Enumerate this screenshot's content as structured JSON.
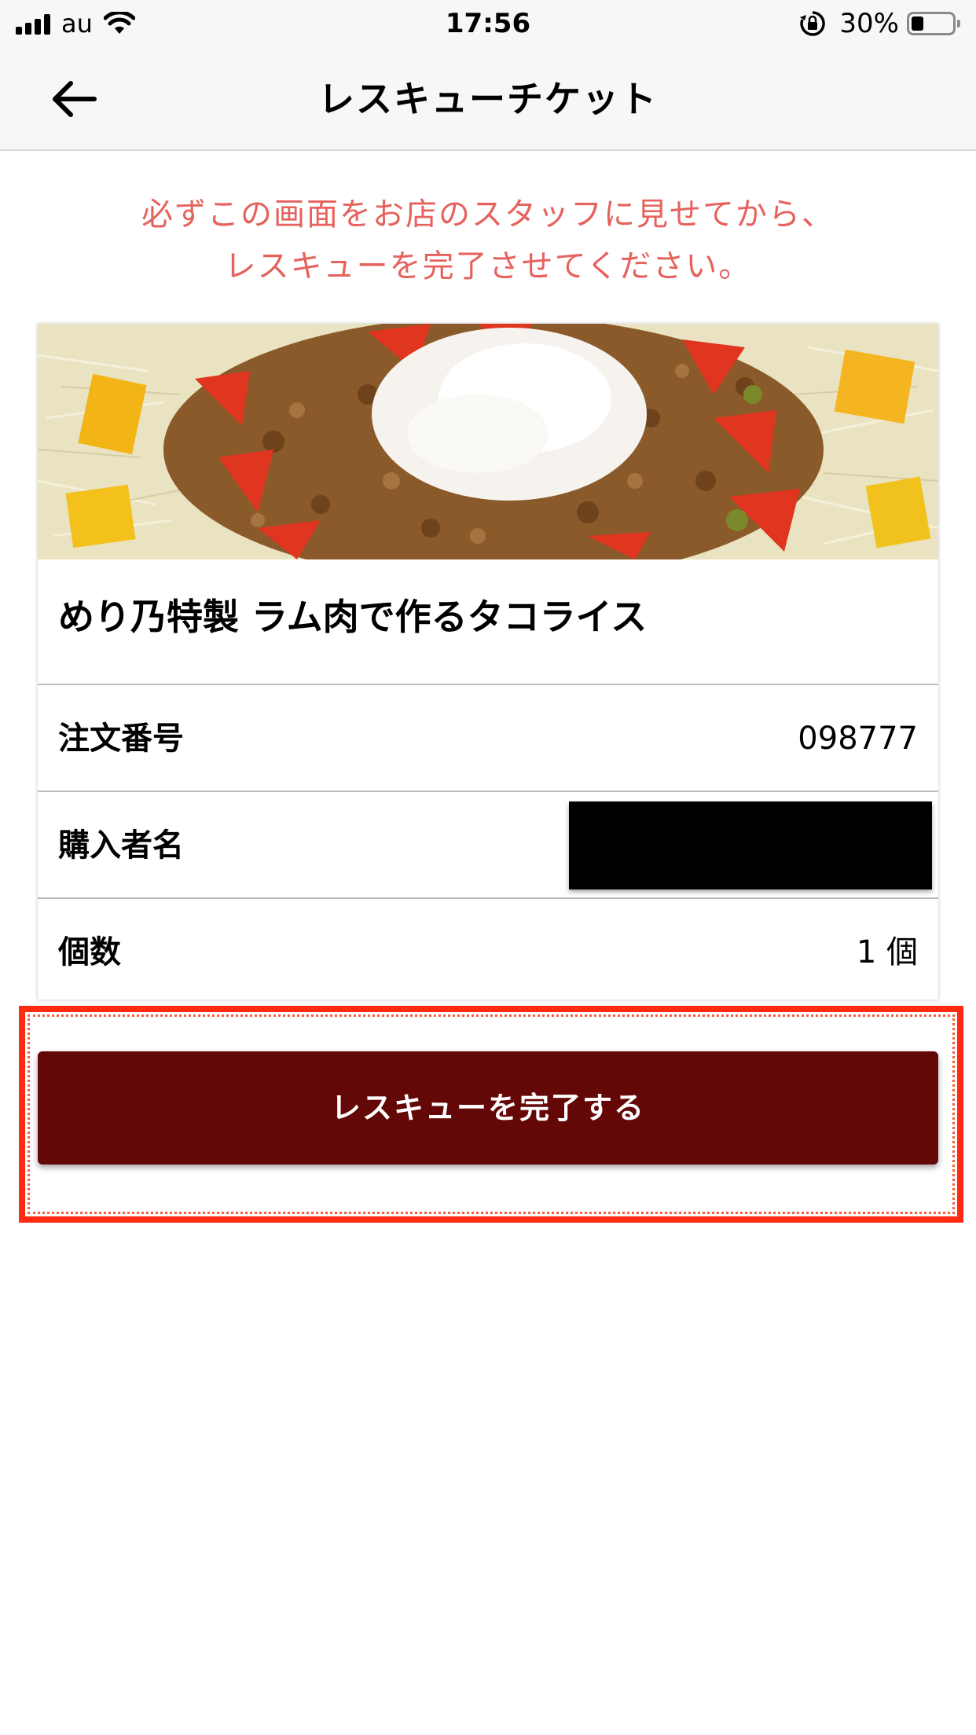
{
  "status_bar": {
    "carrier": "au",
    "time": "17:56",
    "battery_percent": "30%",
    "battery_level": 0.3,
    "icons": [
      "signal-icon",
      "wifi-icon",
      "rotation-lock-icon",
      "battery-icon"
    ]
  },
  "nav": {
    "back_icon": "back-arrow-icon",
    "title": "レスキューチケット"
  },
  "notice": {
    "line1": "必ずこの画面をお店のスタッフに見せてから、",
    "line2": "レスキューを完了させてください。",
    "color": "#e5625d"
  },
  "ticket": {
    "image": "taco-rice-photo",
    "dish_title": "めり乃特製 ラム肉で作るタコライス",
    "rows": [
      {
        "label": "注文番号",
        "value": "098777"
      },
      {
        "label": "購入者名",
        "value": ""
      },
      {
        "label": "個数",
        "value": "1 個"
      }
    ]
  },
  "action": {
    "complete_label": "レスキューを完了する",
    "button_color": "#640707",
    "highlight_color": "#ff2a12"
  }
}
